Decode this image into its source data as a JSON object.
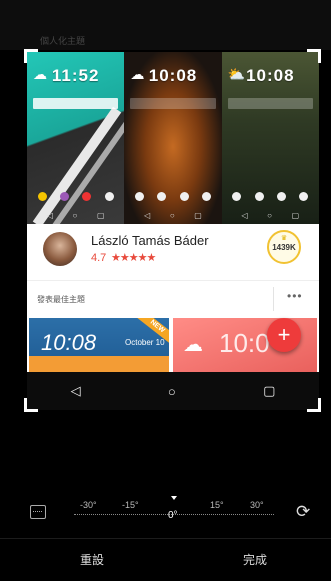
{
  "top": {
    "title": "個人化主題"
  },
  "themes": [
    {
      "clock": "11:52",
      "weather": "☁"
    },
    {
      "clock": "10:08",
      "weather": "☁"
    },
    {
      "clock": "10:08",
      "weather": "⛅"
    }
  ],
  "author": {
    "name": "László Tamás Báder",
    "rating": "4.7",
    "stars": "★★★★★",
    "badge_count": "1439K",
    "badge_crown": "♛"
  },
  "section": {
    "title": "發表最佳主題",
    "more": "•••"
  },
  "cards": {
    "a": {
      "time": "10:08",
      "date": "October 10",
      "ribbon": "NEW"
    },
    "b": {
      "time": "10:0",
      "icon": "☁"
    }
  },
  "fab": {
    "label": "+"
  },
  "nav": {
    "back": "◁",
    "home": "○",
    "recent": "▢"
  },
  "ruler": {
    "minus30": "-30°",
    "minus15": "-15°",
    "zero": "0°",
    "plus15": "15°",
    "plus30": "30°"
  },
  "bottom": {
    "reset": "重設",
    "done": "完成"
  },
  "colors": {
    "fab": "#ee3b3b",
    "accent_rating": "#e84a3c",
    "badge": "#f1c232"
  }
}
